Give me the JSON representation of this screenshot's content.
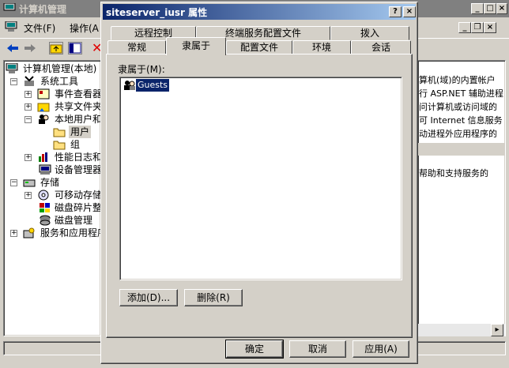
{
  "main_window": {
    "title": "计算机管理",
    "menu": {
      "file": "文件(F)",
      "action": "操作(A"
    }
  },
  "tree": {
    "root": "计算机管理(本地)",
    "system_tools": "系统工具",
    "event_viewer": "事件查看器",
    "shared_folders": "共享文件夹",
    "local_users": "本地用户和",
    "users": "用户",
    "groups": "组",
    "perf_logs": "性能日志和",
    "device_manager": "设备管理器",
    "storage": "存储",
    "removable": "可移动存储",
    "defrag": "磁盘碎片整",
    "disk_mgmt": "磁盘管理",
    "services_apps": "服务和应用程序"
  },
  "right_pane": {
    "lines": [
      "算机(域)的内置帐户",
      "行 ASP.NET 辅助进程",
      "问计算机或访问域的",
      "可 Internet 信息服务",
      "动进程外应用程序的",
      "帮助和支持服务的"
    ]
  },
  "dialog": {
    "title": "siteserver_iusr 属性",
    "help_glyph": "?",
    "close_glyph": "×",
    "tabs_row1": [
      "远程控制",
      "终端服务配置文件",
      "拨入"
    ],
    "tabs_row2": [
      "常规",
      "隶属于",
      "配置文件",
      "环境",
      "会话"
    ],
    "member_of_label": "隶属于(M):",
    "groups": [
      "Guests"
    ],
    "add_button": "添加(D)...",
    "remove_button": "删除(R)",
    "ok_button": "确定",
    "cancel_button": "取消",
    "apply_button": "应用(A)"
  }
}
